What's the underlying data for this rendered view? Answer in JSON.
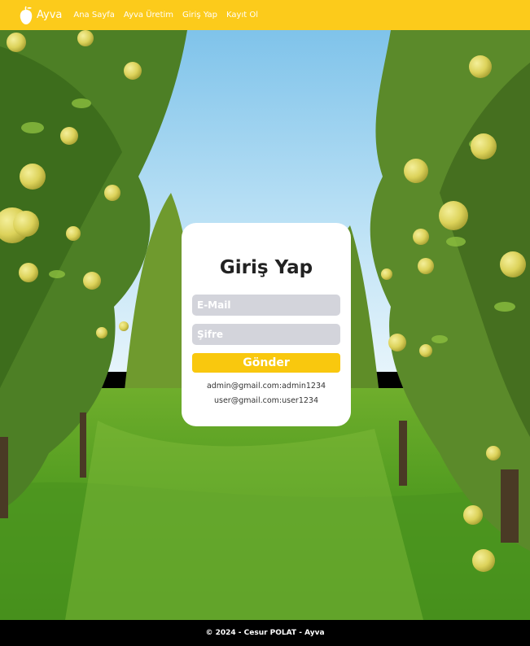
{
  "navbar": {
    "brand": "Ayva",
    "brand_icon": "quince-icon",
    "links": [
      "Ana Sayfa",
      "Ayva Üretim",
      "Giriş Yap",
      "Kayıt Ol"
    ],
    "background": "#fccb1b"
  },
  "login": {
    "title": "Giriş Yap",
    "email_placeholder": "E-Mail",
    "password_placeholder": "Şifre",
    "submit_label": "Gönder",
    "hints": [
      "admin@gmail.com:admin1234",
      "user@gmail.com:user1234"
    ],
    "button_color": "#f9c80e",
    "field_color": "#d3d4db"
  },
  "footer": {
    "text": "© 2024 - Cesur POLAT - Ayva"
  },
  "background": {
    "description_icon": "quince-orchard-image"
  }
}
